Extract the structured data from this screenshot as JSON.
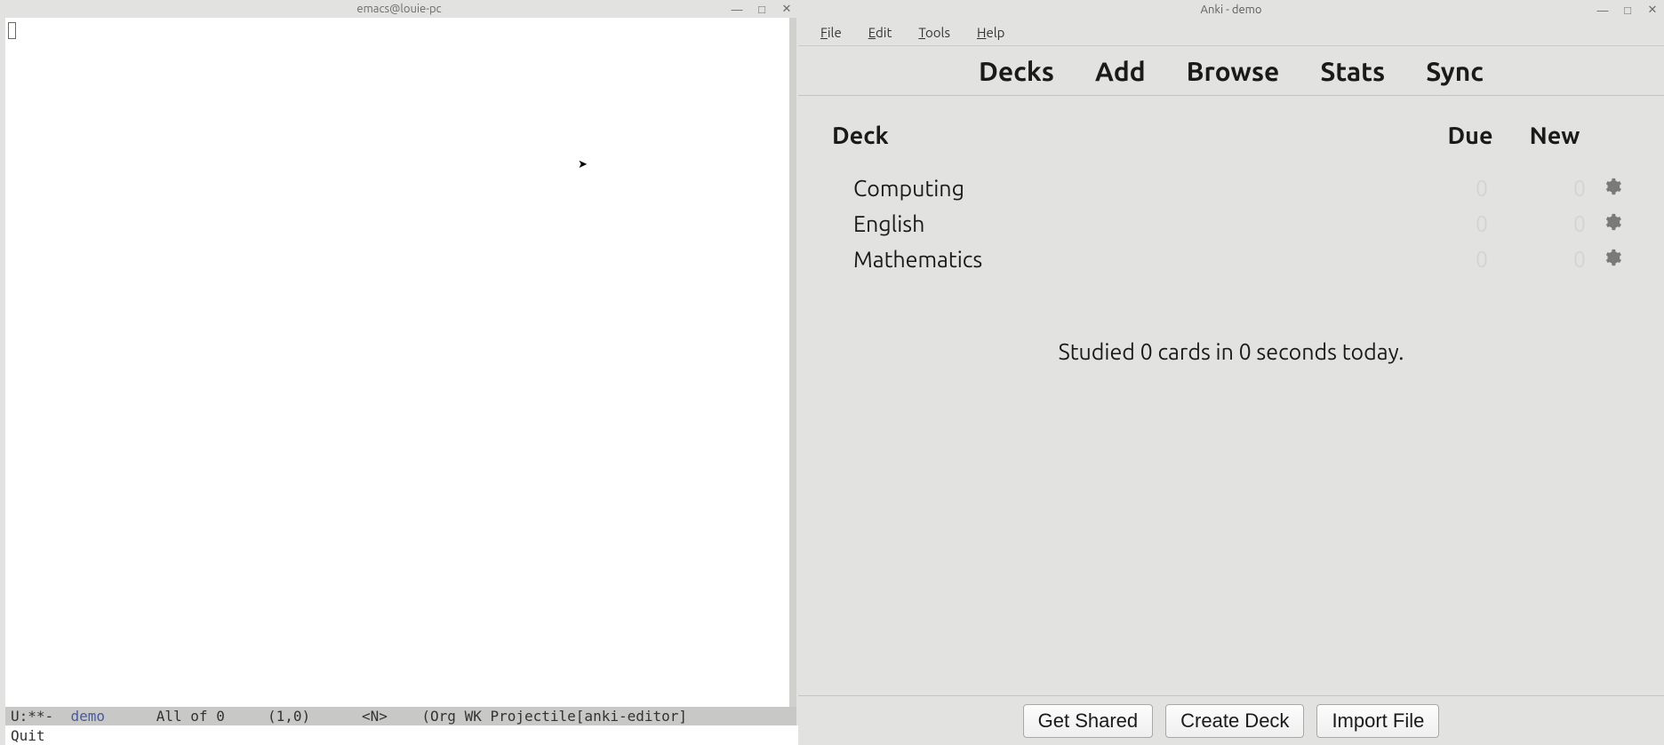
{
  "emacs": {
    "title": "emacs@louie-pc",
    "modeline": {
      "prefix": "U:**-  ",
      "buffer": "demo",
      "gap1": "      ",
      "position": "All of 0",
      "gap2": "     ",
      "line_col": "(1,0)",
      "gap3": "      ",
      "mode_indicator": "<N>",
      "gap4": "    ",
      "modes": "(Org WK Projectile[anki-editor]"
    },
    "minibuffer": "Quit"
  },
  "anki": {
    "title": "Anki - demo",
    "menubar": {
      "file": "File",
      "edit": "Edit",
      "tools": "Tools",
      "help": "Help"
    },
    "toolbar": {
      "decks": "Decks",
      "add": "Add",
      "browse": "Browse",
      "stats": "Stats",
      "sync": "Sync"
    },
    "headers": {
      "deck": "Deck",
      "due": "Due",
      "new": "New"
    },
    "decks": [
      {
        "name": "Computing",
        "due": "0",
        "new": "0"
      },
      {
        "name": "English",
        "due": "0",
        "new": "0"
      },
      {
        "name": "Mathematics",
        "due": "0",
        "new": "0"
      }
    ],
    "stats_line": "Studied 0 cards in 0 seconds today.",
    "footer": {
      "get_shared": "Get Shared",
      "create_deck": "Create Deck",
      "import_file": "Import File"
    }
  }
}
